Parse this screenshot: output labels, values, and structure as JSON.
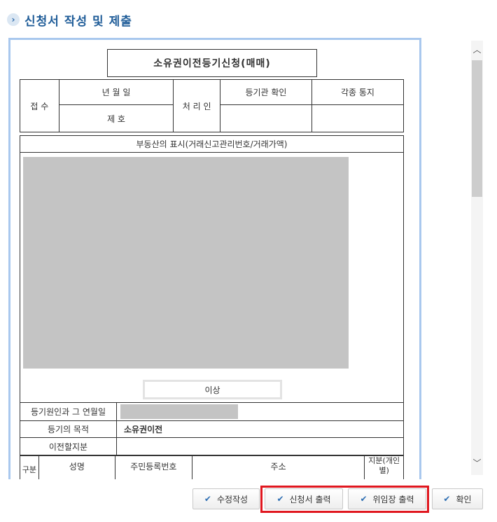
{
  "header": {
    "icon": "chevron-right-icon",
    "title": "신청서 작성 및 제출"
  },
  "form": {
    "title": "소유권이전등기신청(매매)",
    "reception_label": "접 수",
    "date_label": "년    월    일",
    "number_label": "제         호",
    "processor_label": "처 리 인",
    "registrar_label": "등기관 확인",
    "notice_label": "각종 통지",
    "property_label": "부동산의 표시(거래신고관리번호/거래가액)",
    "end_label": "이상",
    "cause_label": "등기원인과 그 연월일",
    "purpose_label": "등기의 목적",
    "purpose_value": "소유권이전",
    "share_label": "이전할지분",
    "party_headers": {
      "category": "구분",
      "name": "성명",
      "id": "주민등록번호",
      "address": "주소",
      "share": "지분(개인별)"
    }
  },
  "buttons": {
    "edit": "수정작성",
    "print_application": "신청서 출력",
    "print_delegation": "위임장 출력",
    "confirm": "확인"
  },
  "colors": {
    "accent": "#1f5c98",
    "highlight": "#e0171f",
    "redacted": "#c4c4c4",
    "frame": "#a9c8ee"
  }
}
